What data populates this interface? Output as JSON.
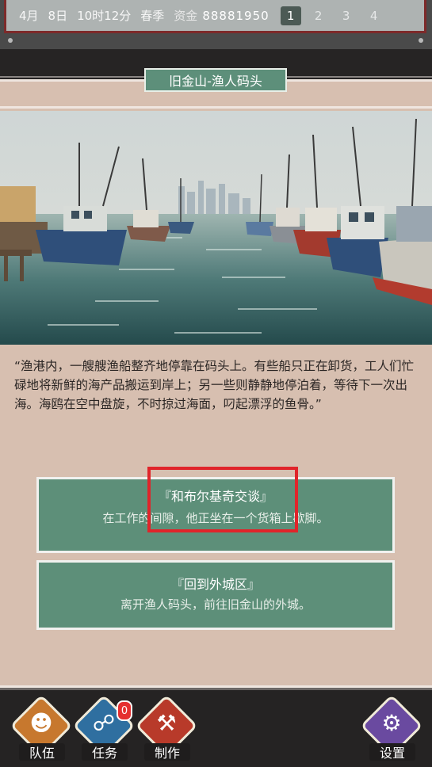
{
  "status_bar": {
    "month": "4月",
    "day": "8日",
    "time": "10时12分",
    "season": "春季",
    "funds_label": "资金",
    "funds_value": "88881950",
    "pages": [
      "1",
      "2",
      "3",
      "4"
    ],
    "active_page": "1"
  },
  "location": {
    "title": "旧金山-渔人码头"
  },
  "scene": {
    "image_subject": "harbor with fishing boats and city skyline"
  },
  "description": "“渔港内，一艘艘渔船整齐地停靠在码头上。有些船只正在卸货，工人们忙碌地将新鲜的海产品搬运到岸上；另一些则静静地停泊着，等待下一次出海。海鸥在空中盘旋，不时掠过海面，叼起漂浮的鱼骨。”",
  "options": [
    {
      "title": "『和布尔基奇交谈』",
      "subtitle": "在工作的间隙，他正坐在一个货箱上歇脚。"
    },
    {
      "title": "『回到外城区』",
      "subtitle": "离开渔人码头，前往旧金山的外城。"
    }
  ],
  "bottom_nav": {
    "team_label": "队伍",
    "task_label": "任务",
    "task_badge": "0",
    "craft_label": "制作",
    "settings_label": "设置"
  },
  "colors": {
    "panel_bg": "#d7bfb0",
    "option_green": "#5d8f79",
    "highlight_red": "#e0242a"
  }
}
